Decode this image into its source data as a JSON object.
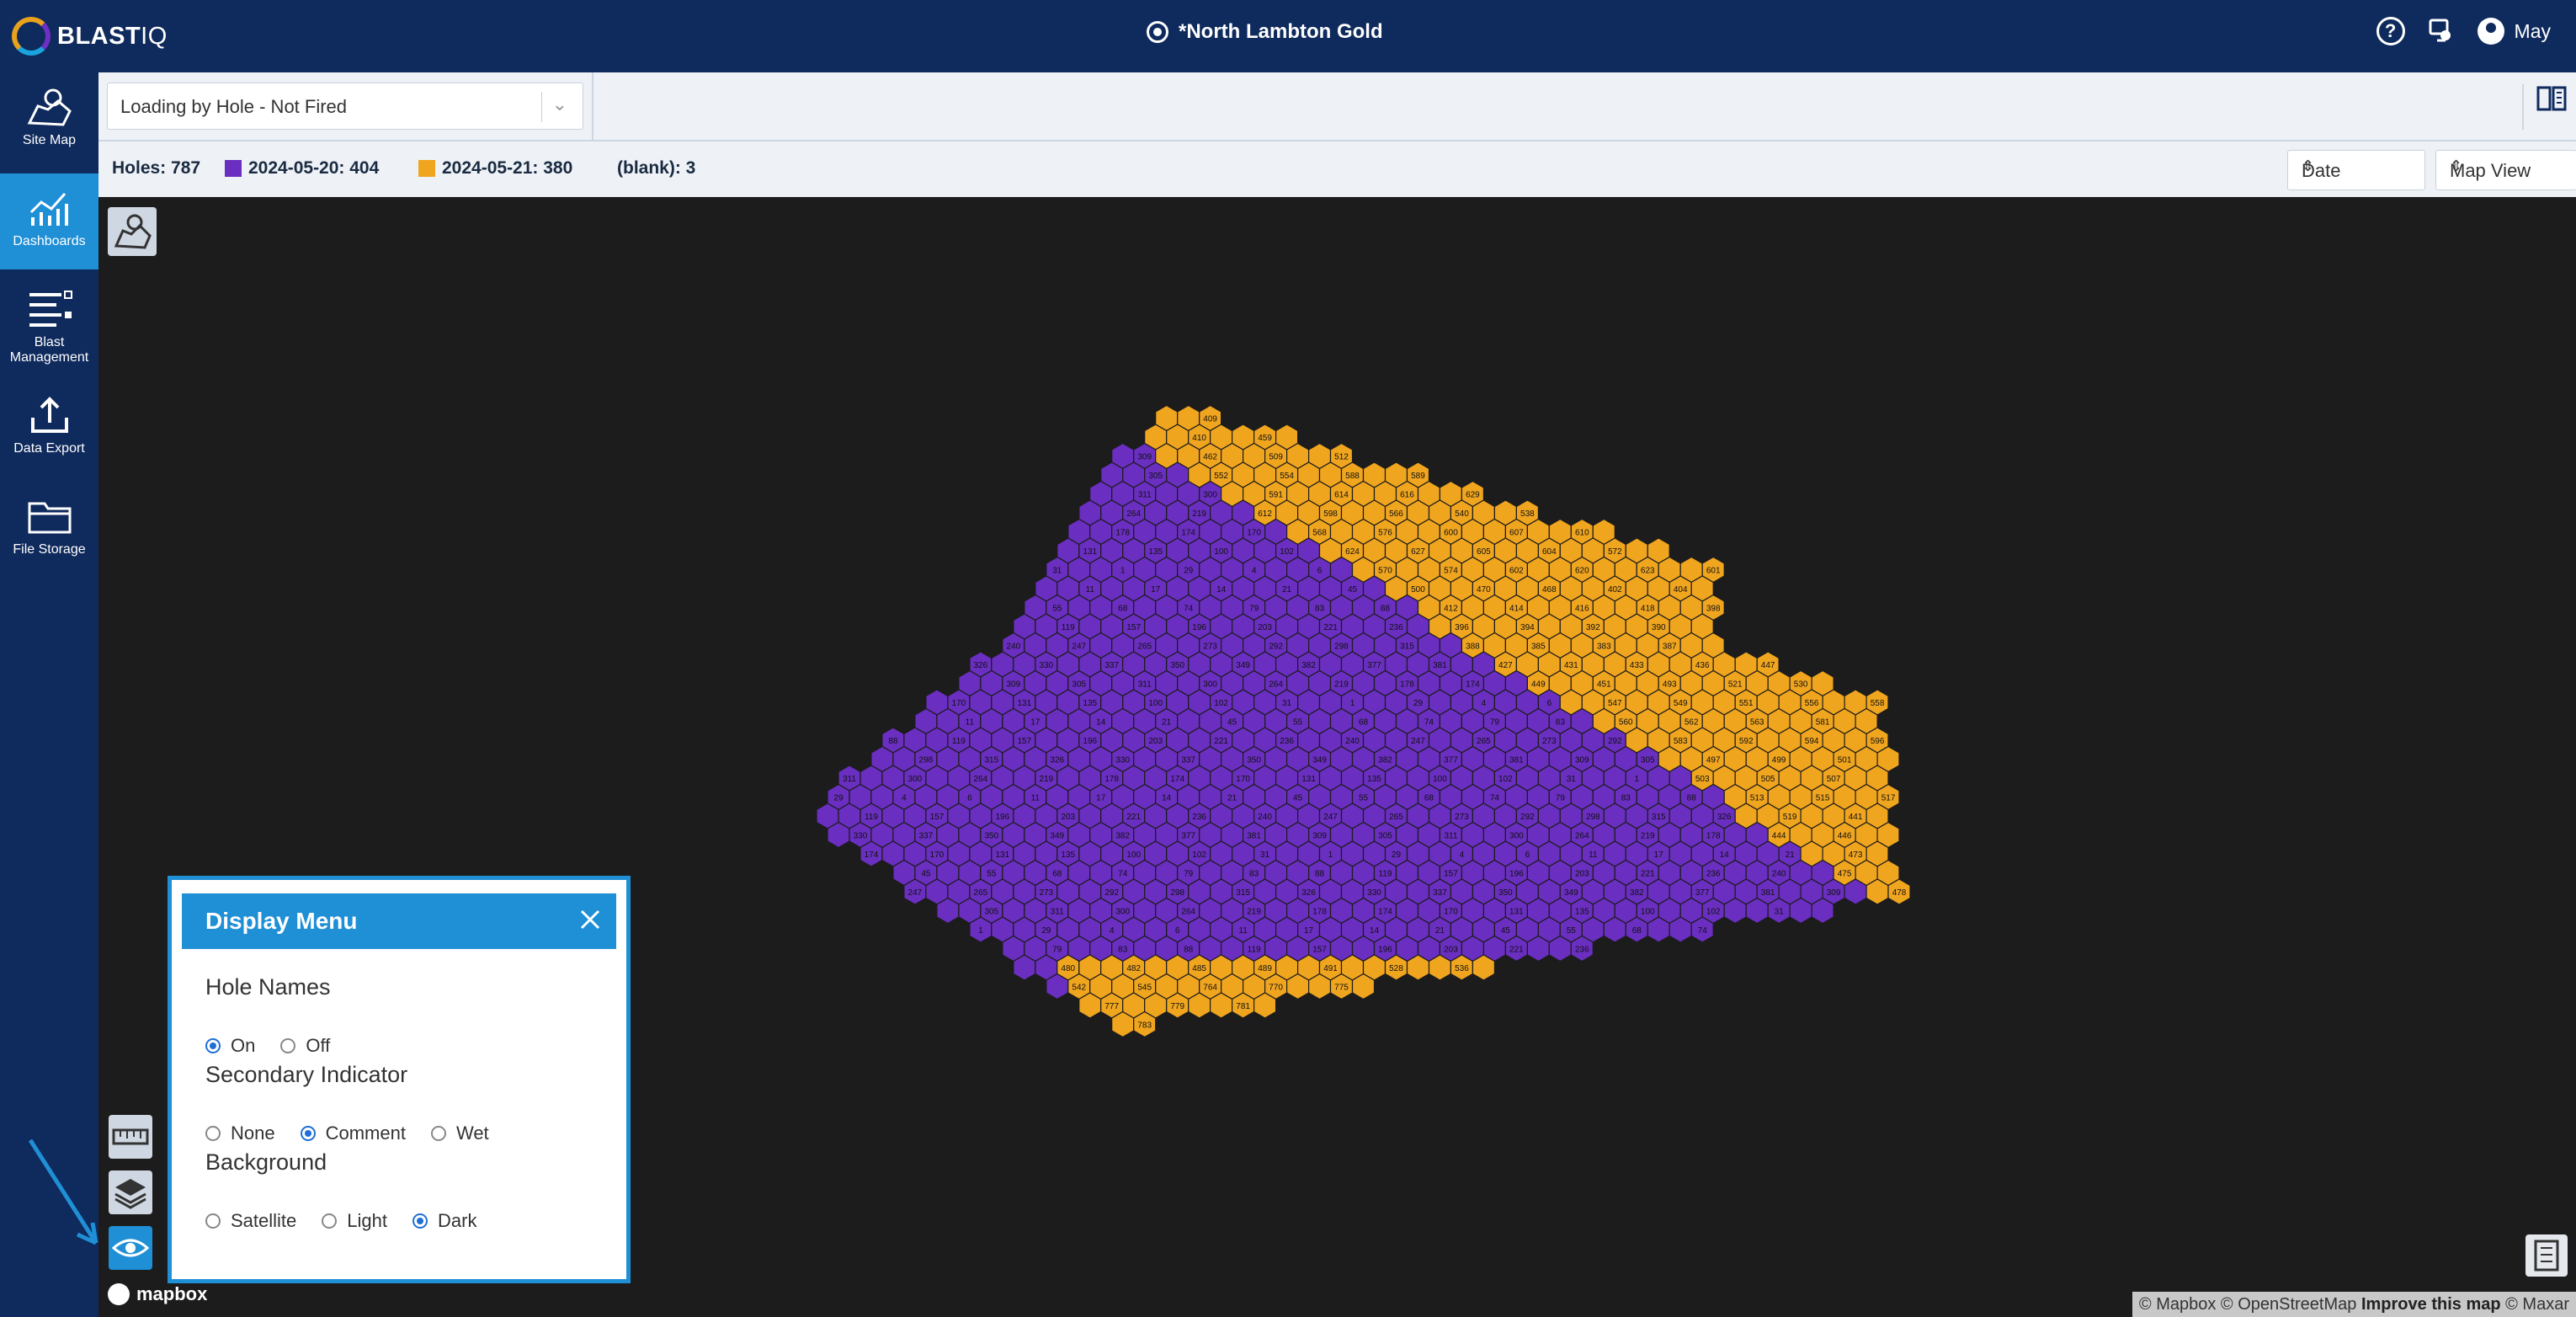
{
  "header": {
    "logo_text": "BLAST",
    "logo_suffix": "IQ",
    "site_name": "*North Lambton Gold",
    "user_name": "May",
    "colors": {
      "bar": "#0f2a5c",
      "accent": "#1f8fd6"
    }
  },
  "sidebar": {
    "items": [
      {
        "label": "Site Map",
        "icon": "map-icon"
      },
      {
        "label": "Dashboards",
        "icon": "dashboard-chart-icon",
        "active": true
      },
      {
        "label": "Blast Management",
        "icon": "list-management-icon"
      },
      {
        "label": "Data Export",
        "icon": "upload-export-icon"
      },
      {
        "label": "File Storage",
        "icon": "folder-icon"
      }
    ]
  },
  "toolbar": {
    "view_select_value": "Loading by Hole - Not Fired"
  },
  "legend": {
    "holes_label": "Holes: 787",
    "entries": [
      {
        "label": "2024-05-20: 404",
        "color": "#6a2ec0"
      },
      {
        "label": "2024-05-21: 380",
        "color": "#f0a51f"
      }
    ],
    "blank_label": "(blank): 3",
    "date_select": "Date",
    "mapview_select": "Map View"
  },
  "display_menu": {
    "title": "Display Menu",
    "hole_names": {
      "title": "Hole Names",
      "options": [
        "On",
        "Off"
      ],
      "selected": "On"
    },
    "secondary_indicator": {
      "title": "Secondary Indicator",
      "options": [
        "None",
        "Comment",
        "Wet"
      ],
      "selected": "Comment"
    },
    "background": {
      "title": "Background",
      "options": [
        "Satellite",
        "Light",
        "Dark"
      ],
      "selected": "Dark"
    }
  },
  "map": {
    "attribution_1": "© Mapbox © OpenStreetMap",
    "attribution_2": "Improve this map",
    "attribution_3": "© Maxar",
    "mapbox_text": "mapbox",
    "hole_labels_purple": [
      "309",
      "305",
      "311",
      "300",
      "264",
      "219",
      "178",
      "174",
      "170",
      "131",
      "135",
      "100",
      "102",
      "31",
      "1",
      "29",
      "4",
      "6",
      "11",
      "17",
      "14",
      "21",
      "45",
      "55",
      "68",
      "74",
      "79",
      "83",
      "88",
      "119",
      "157",
      "196",
      "203",
      "221",
      "236",
      "240",
      "247",
      "265",
      "273",
      "292",
      "298",
      "315",
      "326",
      "330",
      "337",
      "350",
      "349",
      "382",
      "377",
      "381"
    ],
    "hole_labels_orange": [
      "409",
      "410",
      "459",
      "462",
      "509",
      "512",
      "552",
      "554",
      "588",
      "589",
      "591",
      "614",
      "616",
      "629",
      "612",
      "598",
      "566",
      "540",
      "538",
      "568",
      "576",
      "600",
      "607",
      "610",
      "624",
      "627",
      "605",
      "604",
      "572",
      "570",
      "574",
      "602",
      "620",
      "623",
      "601",
      "500",
      "470",
      "468",
      "402",
      "404",
      "412",
      "414",
      "416",
      "418",
      "398",
      "396",
      "394",
      "392",
      "390",
      "388",
      "385",
      "383",
      "387",
      "427",
      "431",
      "433",
      "436",
      "447",
      "449",
      "451",
      "493",
      "521",
      "530",
      "547",
      "549",
      "551",
      "556",
      "558",
      "560",
      "562",
      "563",
      "581",
      "583",
      "592",
      "594",
      "596",
      "497",
      "499",
      "501",
      "503",
      "505",
      "507",
      "513",
      "515",
      "517",
      "519",
      "441",
      "444",
      "446",
      "473",
      "475",
      "478",
      "480",
      "482",
      "485",
      "489",
      "491",
      "528",
      "536",
      "542",
      "545",
      "764",
      "770",
      "775",
      "777",
      "779",
      "781",
      "783",
      "785",
      "787"
    ]
  }
}
